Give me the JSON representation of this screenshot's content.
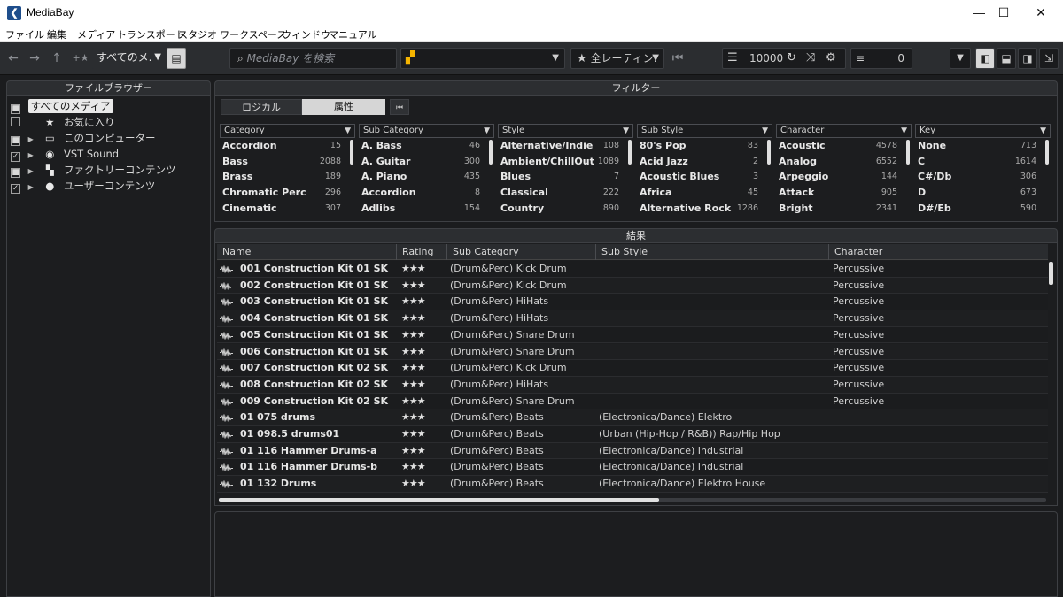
{
  "window": {
    "title": "MediaBay",
    "controls": {
      "minimize": "—",
      "maximize": "☐",
      "close": "✕"
    }
  },
  "menu": [
    "ファイル",
    "編集",
    "メディア",
    "トランスポート",
    "スタジオ",
    "ワークスペース",
    "ウィンドウ",
    "マニュアル"
  ],
  "toolbar": {
    "back": "←",
    "forward": "→",
    "up": "↑",
    "fav": "+★",
    "location": "すべてのメ.",
    "search_placeholder": "MediaBay を検索",
    "rating_filter": "全レーティン.",
    "result_limit": "10000",
    "result_count": "0"
  },
  "file_browser": {
    "title": "ファイルブラウザー",
    "items": [
      {
        "label": "すべてのメディア",
        "check": "■",
        "selected": true
      },
      {
        "label": "お気に入り",
        "check": "",
        "icon": "★"
      },
      {
        "label": "このコンピューター",
        "check": "■",
        "icon": "▭"
      },
      {
        "label": "VST Sound",
        "check": "✓",
        "icon": "◉"
      },
      {
        "label": "ファクトリーコンテンツ",
        "check": "■",
        "icon": "▚"
      },
      {
        "label": "ユーザーコンテンツ",
        "check": "✓",
        "icon": "●"
      }
    ]
  },
  "filter": {
    "title": "フィルター",
    "modes": [
      "ロジカル",
      "属性"
    ],
    "reset": "⏮",
    "columns": [
      {
        "header": "Category",
        "rows": [
          [
            "Accordion",
            "15"
          ],
          [
            "Bass",
            "2088"
          ],
          [
            "Brass",
            "189"
          ],
          [
            "Chromatic Perc",
            "296"
          ],
          [
            "Cinematic",
            "307"
          ]
        ]
      },
      {
        "header": "Sub Category",
        "rows": [
          [
            "A. Bass",
            "46"
          ],
          [
            "A. Guitar",
            "300"
          ],
          [
            "A. Piano",
            "435"
          ],
          [
            "Accordion",
            "8"
          ],
          [
            "Adlibs",
            "154"
          ]
        ]
      },
      {
        "header": "Style",
        "rows": [
          [
            "Alternative/Indie",
            "108"
          ],
          [
            "Ambient/ChillOut",
            "1089"
          ],
          [
            "Blues",
            "7"
          ],
          [
            "Classical",
            "222"
          ],
          [
            "Country",
            "890"
          ]
        ]
      },
      {
        "header": "Sub Style",
        "rows": [
          [
            "80's Pop",
            "83"
          ],
          [
            "Acid Jazz",
            "2"
          ],
          [
            "Acoustic Blues",
            "3"
          ],
          [
            "Africa",
            "45"
          ],
          [
            "Alternative Rock",
            "1286"
          ]
        ]
      },
      {
        "header": "Character",
        "rows": [
          [
            "Acoustic",
            "4578"
          ],
          [
            "Analog",
            "6552"
          ],
          [
            "Arpeggio",
            "144"
          ],
          [
            "Attack",
            "905"
          ],
          [
            "Bright",
            "2341"
          ]
        ]
      },
      {
        "header": "Key",
        "rows": [
          [
            "None",
            "713"
          ],
          [
            "C",
            "1614"
          ],
          [
            "C#/Db",
            "306"
          ],
          [
            "D",
            "673"
          ],
          [
            "D#/Eb",
            "590"
          ]
        ]
      }
    ]
  },
  "results": {
    "title": "結果",
    "headers": [
      "Name",
      "Rating",
      "Sub Category",
      "Sub Style",
      "Character"
    ],
    "rows": [
      [
        "001 Construction Kit 01 SK",
        "★★★",
        "(Drum&Perc) Kick Drum",
        "",
        "Percussive"
      ],
      [
        "002 Construction Kit 01 SK",
        "★★★",
        "(Drum&Perc) Kick Drum",
        "",
        "Percussive"
      ],
      [
        "003 Construction Kit 01 SK",
        "★★★",
        "(Drum&Perc) HiHats",
        "",
        "Percussive"
      ],
      [
        "004 Construction Kit 01 SK",
        "★★★",
        "(Drum&Perc) HiHats",
        "",
        "Percussive"
      ],
      [
        "005 Construction Kit 01 SK",
        "★★★",
        "(Drum&Perc) Snare Drum",
        "",
        "Percussive"
      ],
      [
        "006 Construction Kit 01 SK",
        "★★★",
        "(Drum&Perc) Snare Drum",
        "",
        "Percussive"
      ],
      [
        "007 Construction Kit 02 SK",
        "★★★",
        "(Drum&Perc) Kick Drum",
        "",
        "Percussive"
      ],
      [
        "008 Construction Kit 02 SK",
        "★★★",
        "(Drum&Perc) HiHats",
        "",
        "Percussive"
      ],
      [
        "009 Construction Kit 02 SK",
        "★★★",
        "(Drum&Perc) Snare Drum",
        "",
        "Percussive"
      ],
      [
        "01 075 drums",
        "★★★",
        "(Drum&Perc) Beats",
        "(Electronica/Dance) Elektro",
        ""
      ],
      [
        "01 098.5 drums01",
        "★★★",
        "(Drum&Perc) Beats",
        "(Urban (Hip-Hop / R&B)) Rap/Hip Hop",
        ""
      ],
      [
        "01 116 Hammer Drums-a",
        "★★★",
        "(Drum&Perc) Beats",
        "(Electronica/Dance) Industrial",
        ""
      ],
      [
        "01 116 Hammer Drums-b",
        "★★★",
        "(Drum&Perc) Beats",
        "(Electronica/Dance) Industrial",
        ""
      ],
      [
        "01 132 Drums",
        "★★★",
        "(Drum&Perc) Beats",
        "(Electronica/Dance) Elektro House",
        ""
      ]
    ]
  },
  "colors": {
    "accent": "#f5b400",
    "bg": "#1b1c1e",
    "panel": "#2c2e31"
  }
}
